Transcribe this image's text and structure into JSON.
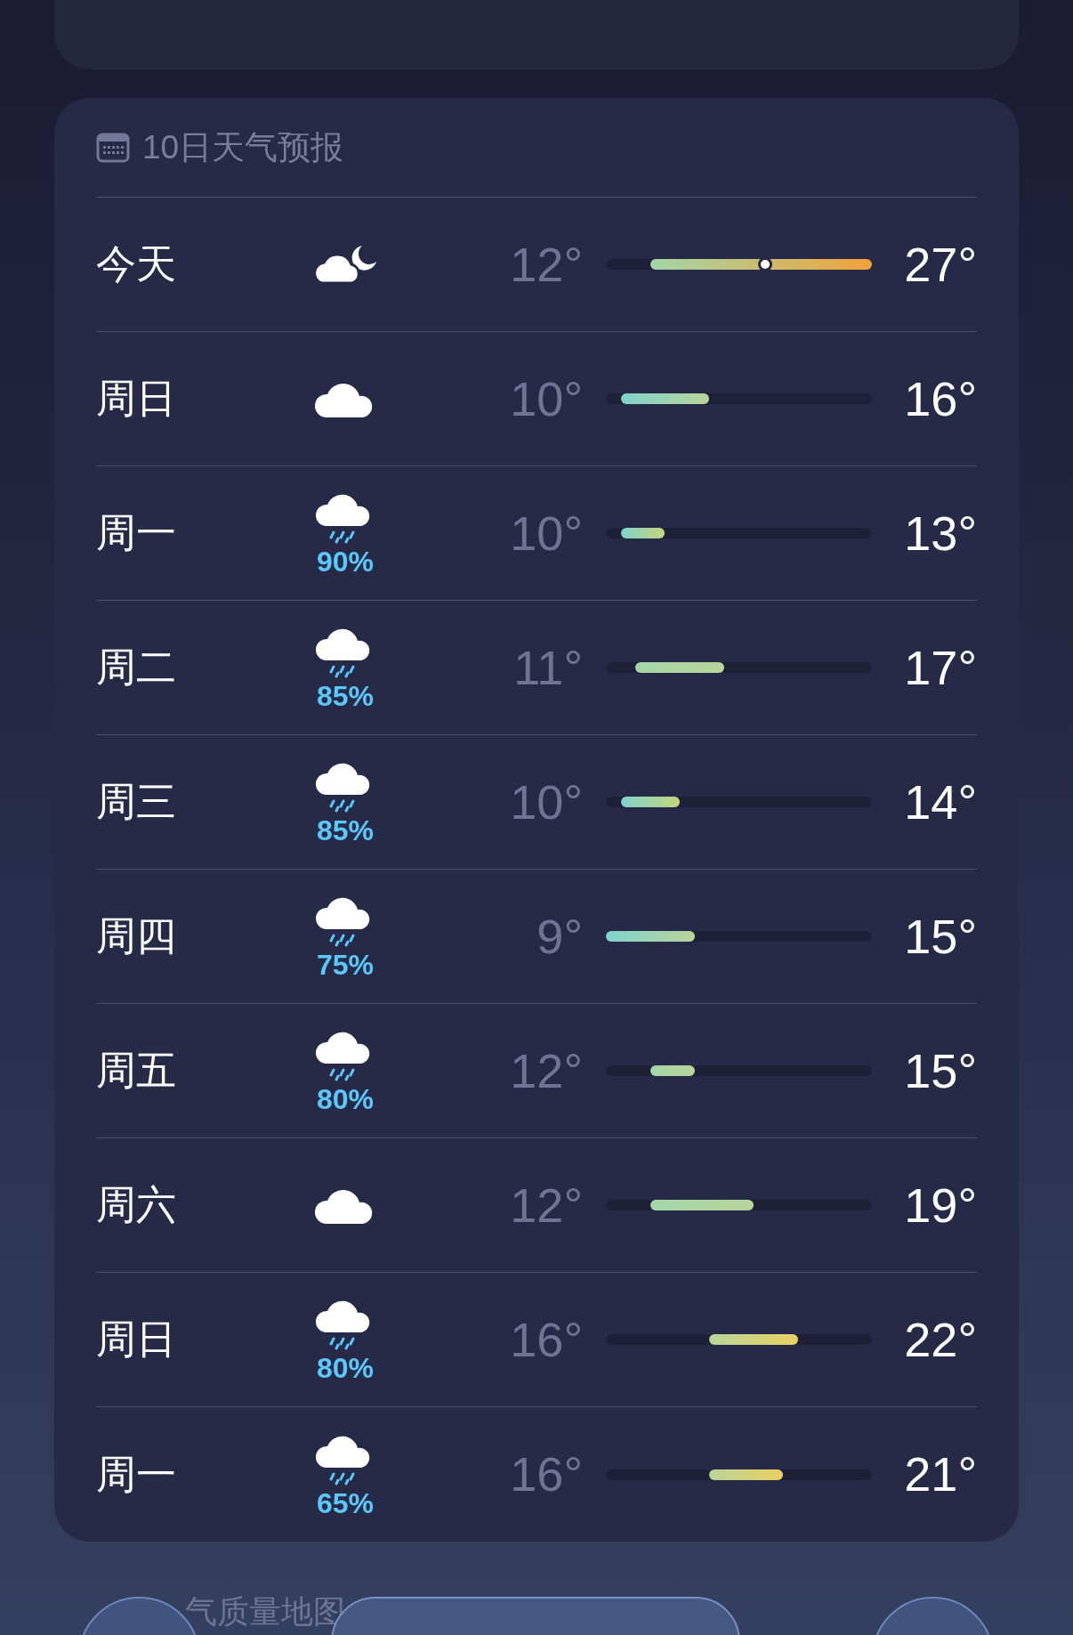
{
  "forecast": {
    "title": "10日天气预报",
    "days": [
      {
        "day": "今天",
        "kind": "partly_cloudy_night",
        "low": "12°",
        "high": "27°",
        "now": {
          "level": 0.6
        }
      },
      {
        "day": "周日",
        "kind": "cloudy",
        "low": "10°",
        "high": "16°"
      },
      {
        "day": "周一",
        "kind": "rain",
        "precip": "90%",
        "low": "10°",
        "high": "13°"
      },
      {
        "day": "周二",
        "kind": "rain",
        "precip": "85%",
        "low": "11°",
        "high": "17°"
      },
      {
        "day": "周三",
        "kind": "rain",
        "precip": "85%",
        "low": "10°",
        "high": "14°"
      },
      {
        "day": "周四",
        "kind": "rain",
        "precip": "75%",
        "low": "9°",
        "high": "15°"
      },
      {
        "day": "周五",
        "kind": "rain",
        "precip": "80%",
        "low": "12°",
        "high": "15°"
      },
      {
        "day": "周六",
        "kind": "cloudy",
        "low": "12°",
        "high": "19°"
      },
      {
        "day": "周日",
        "kind": "rain",
        "precip": "80%",
        "low": "16°",
        "high": "22°"
      },
      {
        "day": "周一",
        "kind": "rain",
        "precip": "65%",
        "low": "16°",
        "high": "21°"
      }
    ]
  },
  "bottom_caption": "气质量地图"
}
